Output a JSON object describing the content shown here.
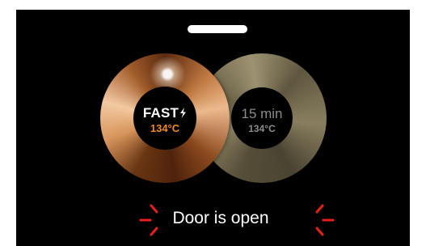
{
  "colors": {
    "screen_background": "#000000",
    "alert_red": "#e8201c",
    "temperature_orange": "#f08a20",
    "inactive_text": "#8c8c8c"
  },
  "modes": [
    {
      "label": "FAST",
      "icon": "lightning-bolt-icon",
      "temperature": "134°C",
      "selected": true
    },
    {
      "label": "15 min",
      "temperature": "134°C",
      "selected": false
    }
  ],
  "status": {
    "message": "Door is open",
    "icon": "alert-rays-icon"
  }
}
